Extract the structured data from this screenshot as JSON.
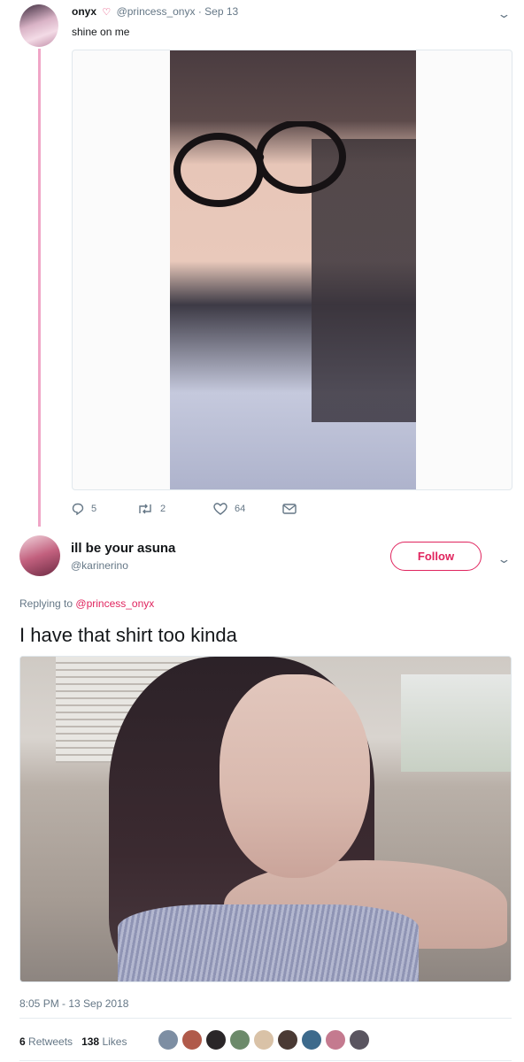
{
  "tweet1": {
    "display_name": "onyx",
    "handle": "@princess_onyx",
    "separator": "·",
    "date": "Sep 13",
    "text": "shine on me",
    "actions": {
      "replies": "5",
      "retweets": "2",
      "likes": "64"
    }
  },
  "tweet2": {
    "display_name": "ill be your asuna",
    "handle": "@karinerino",
    "follow_label": "Follow",
    "replying_prefix": "Replying to",
    "replying_to": "@princess_onyx",
    "text": "I have that shirt too kinda",
    "timestamp": "8:05 PM - 13 Sep 2018",
    "retweets_count": "6",
    "retweets_label": "Retweets",
    "likes_count": "138",
    "likes_label": "Likes"
  },
  "colors": {
    "accent": "#e0245e",
    "thread_line": "#f0a6c7",
    "secondary_text": "#657786"
  },
  "liker_avatars": [
    "liker-avatar-1",
    "liker-avatar-2",
    "liker-avatar-3",
    "liker-avatar-4",
    "liker-avatar-5",
    "liker-avatar-6",
    "liker-avatar-7",
    "liker-avatar-8",
    "liker-avatar-9"
  ]
}
